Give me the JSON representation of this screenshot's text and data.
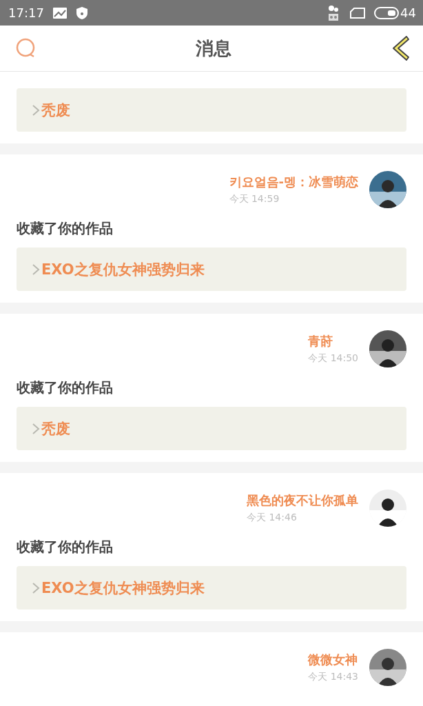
{
  "status_bar": {
    "time": "17:17",
    "battery": "44"
  },
  "header": {
    "title": "消息"
  },
  "messages": [
    {
      "kind": "partial",
      "work": "秃废"
    },
    {
      "kind": "full",
      "name": "키요얼음-멩：冰雪萌恋",
      "time": "今天 14:59",
      "action": "收藏了你的作品",
      "work": "EXO之复仇女神强势归来"
    },
    {
      "kind": "full",
      "name": "青莳",
      "time": "今天 14:50",
      "action": "收藏了你的作品",
      "work": "秃废"
    },
    {
      "kind": "full",
      "name": "黑色的夜不让你孤单",
      "time": "今天 14:46",
      "action": "收藏了你的作品",
      "work": "EXO之复仇女神强势归来"
    },
    {
      "kind": "head",
      "name": "微微女神",
      "time": "今天 14:43"
    }
  ]
}
